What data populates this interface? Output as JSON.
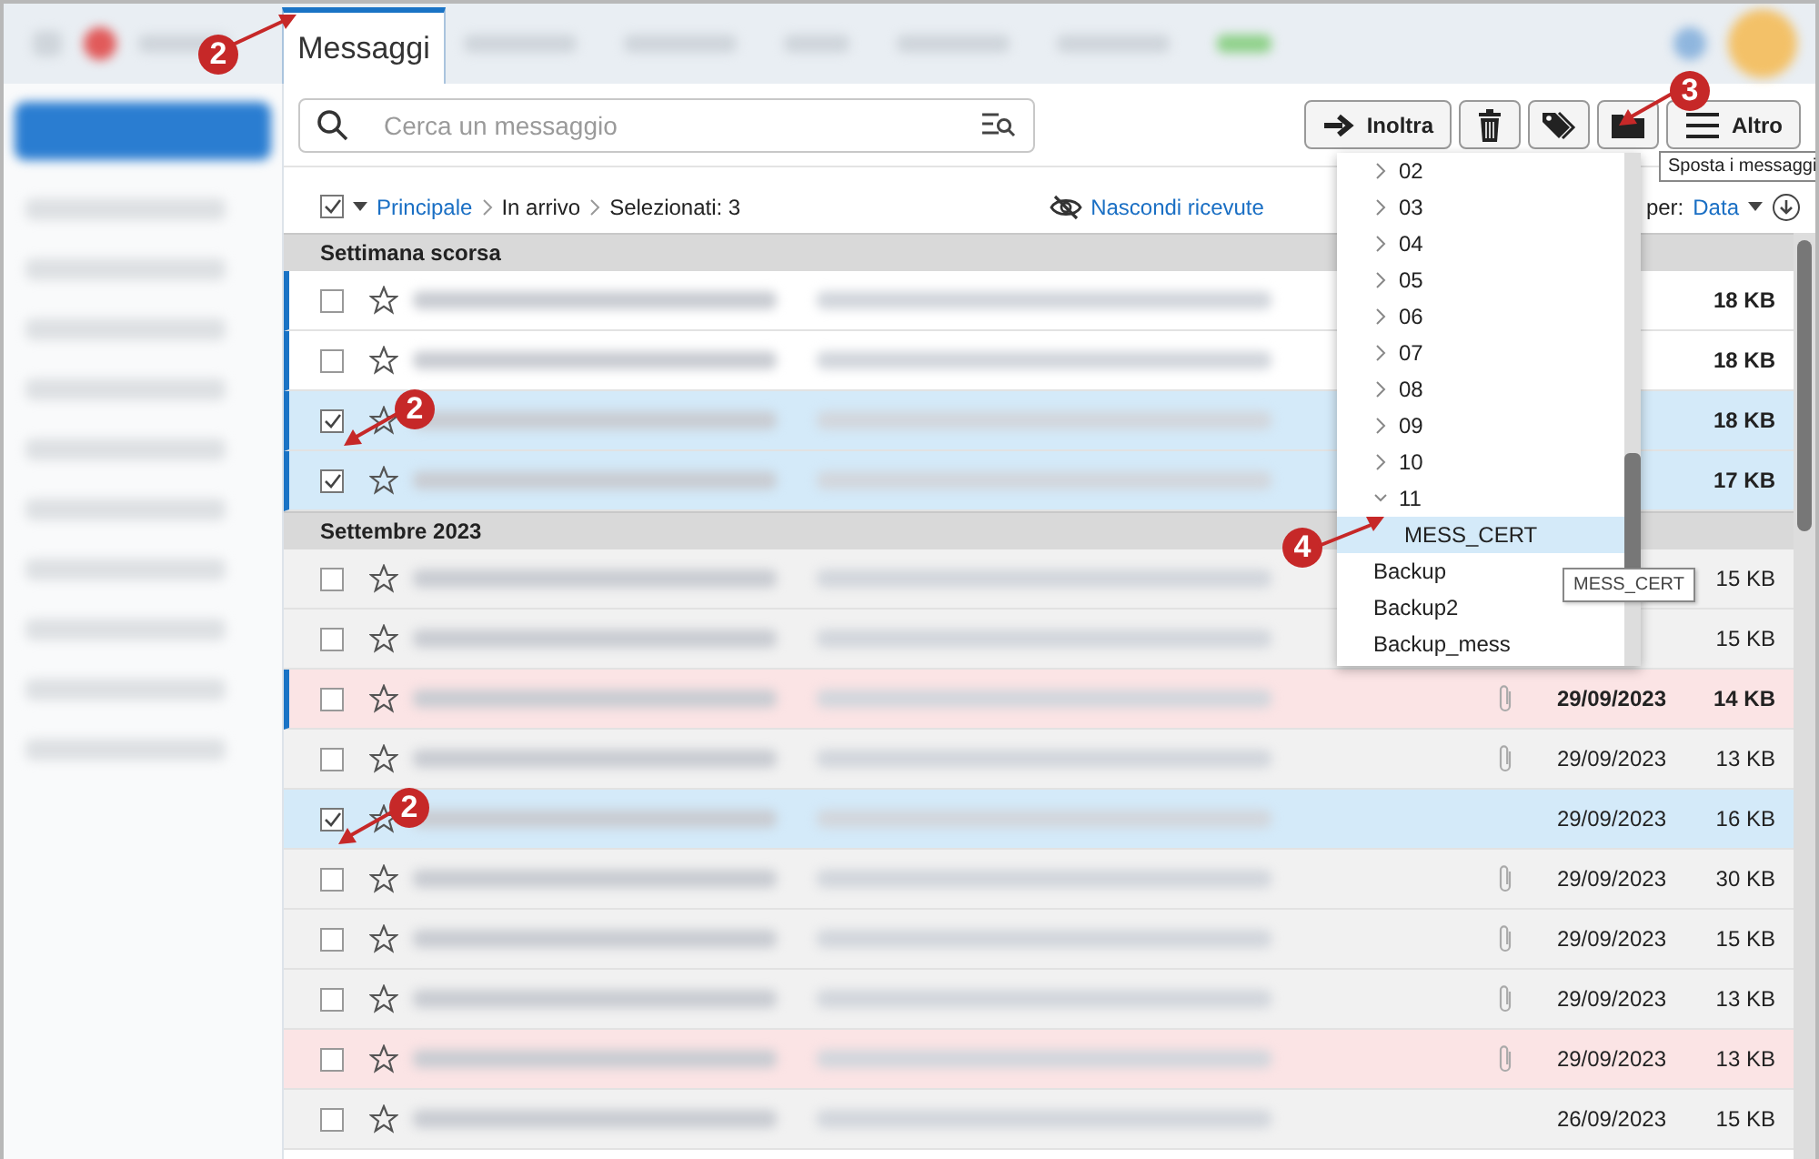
{
  "top_bar": {
    "tabs": [
      {
        "label": "Messaggi",
        "selected": true,
        "callout": "2"
      }
    ]
  },
  "search": {
    "placeholder": "Cerca un messaggio"
  },
  "toolbar": {
    "buttons": [
      {
        "kind": "forward",
        "label": "Inoltra"
      },
      {
        "kind": "trash"
      },
      {
        "kind": "tag"
      },
      {
        "kind": "folder",
        "callout": "3",
        "tooltip": "Sposta i messaggi"
      },
      {
        "kind": "menu",
        "label": "Altro"
      }
    ]
  },
  "breadcrumb": {
    "select_all_checked": true,
    "items": [
      "Principale",
      "In arrivo",
      "Selezionati: 3"
    ]
  },
  "hide_receipts": "Nascondi ricevute",
  "sort": {
    "prefix": "per:",
    "field": "Data"
  },
  "groups": [
    {
      "title": "Settimana scorsa",
      "rows": [
        {
          "checked": false,
          "unread": true,
          "attachment": false,
          "size": "18 KB"
        },
        {
          "checked": false,
          "unread": true,
          "attachment": false,
          "size": "18 KB"
        },
        {
          "checked": true,
          "unread": true,
          "attachment": false,
          "size": "18 KB",
          "callout": "2"
        },
        {
          "checked": true,
          "unread": true,
          "attachment": false,
          "size": "17 KB"
        }
      ]
    },
    {
      "title": "Settembre 2023",
      "rows": [
        {
          "checked": false,
          "unread": false,
          "attachment": false,
          "size": "15 KB"
        },
        {
          "checked": false,
          "unread": false,
          "attachment": false,
          "size": "15 KB"
        },
        {
          "checked": false,
          "unread": true,
          "attachment": true,
          "date": "29/09/2023",
          "size": "14 KB",
          "color": "#fbe4e5"
        },
        {
          "checked": false,
          "unread": false,
          "attachment": true,
          "date": "29/09/2023",
          "size": "13 KB"
        },
        {
          "checked": true,
          "unread": false,
          "attachment": false,
          "date": "29/09/2023",
          "size": "16 KB",
          "callout": "2"
        },
        {
          "checked": false,
          "unread": false,
          "attachment": true,
          "date": "29/09/2023",
          "size": "30 KB"
        },
        {
          "checked": false,
          "unread": false,
          "attachment": true,
          "date": "29/09/2023",
          "size": "15 KB"
        },
        {
          "checked": false,
          "unread": false,
          "attachment": true,
          "date": "29/09/2023",
          "size": "13 KB"
        },
        {
          "checked": false,
          "unread": false,
          "attachment": true,
          "date": "29/09/2023",
          "size": "13 KB",
          "color": "#fbe4e5"
        },
        {
          "checked": false,
          "unread": false,
          "attachment": false,
          "date": "26/09/2023",
          "size": "15 KB"
        }
      ]
    }
  ],
  "folder_menu": {
    "items": [
      {
        "name": "02",
        "expanded": false
      },
      {
        "name": "03",
        "expanded": false
      },
      {
        "name": "04",
        "expanded": false
      },
      {
        "name": "05",
        "expanded": false
      },
      {
        "name": "06",
        "expanded": false
      },
      {
        "name": "07",
        "expanded": false
      },
      {
        "name": "08",
        "expanded": false
      },
      {
        "name": "09",
        "expanded": false
      },
      {
        "name": "10",
        "expanded": false
      },
      {
        "name": "11",
        "expanded": true,
        "selected": false,
        "children": [
          {
            "name": "MESS_CERT",
            "selected": true,
            "callout": "4",
            "tooltip": "MESS_CERT"
          }
        ]
      },
      {
        "name": "Backup",
        "selected": false
      },
      {
        "name": "Backup2",
        "selected": false
      },
      {
        "name": "Backup_mess",
        "selected": false
      }
    ]
  }
}
